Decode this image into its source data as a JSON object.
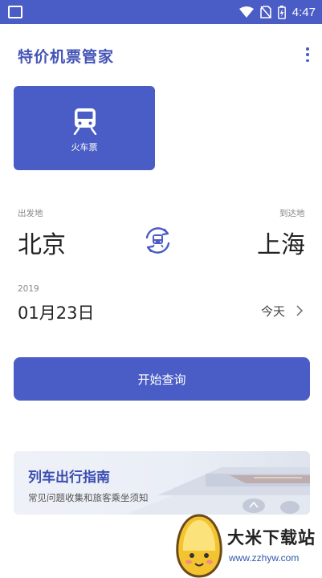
{
  "status_bar": {
    "time": "4:47",
    "icons": [
      "wifi-icon",
      "no-sim-icon",
      "battery-charging-icon"
    ]
  },
  "header": {
    "title": "特价机票管家",
    "menu_icon": "more-vert-icon"
  },
  "transport_card": {
    "icon": "train-icon",
    "label": "火车票"
  },
  "route": {
    "from_label": "出发地",
    "from_city": "北京",
    "to_label": "到达地",
    "to_city": "上海",
    "swap_icon": "swap-train-icon"
  },
  "date": {
    "year": "2019",
    "value": "01月23日",
    "relative": "今天",
    "chevron_icon": "chevron-right-icon"
  },
  "search_button": {
    "label": "开始查询"
  },
  "guide_banner": {
    "title": "列车出行指南",
    "subtitle": "常见问题收集和旅客乘坐须知"
  },
  "watermark": {
    "name": "大米下载站",
    "url": "www.zzhyw.com"
  },
  "colors": {
    "primary": "#4a5cc5",
    "title": "#4454b8"
  }
}
